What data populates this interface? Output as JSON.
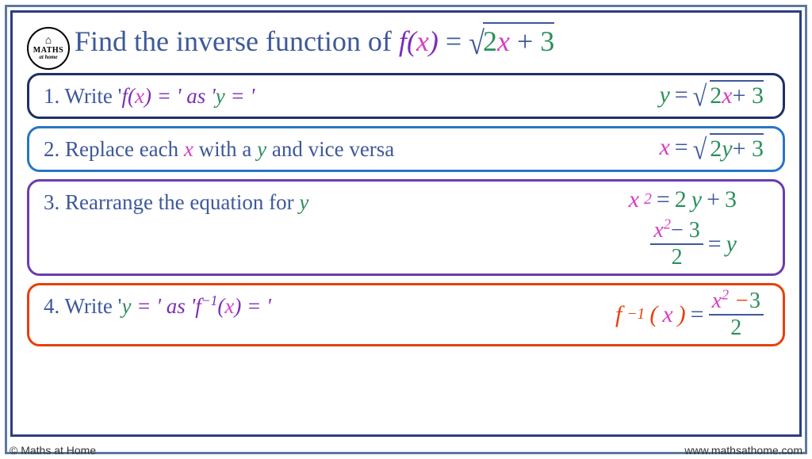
{
  "logo": {
    "line1": "MATHS",
    "line2": "at home"
  },
  "title": {
    "prefix": "Find the inverse function of ",
    "func": "f",
    "var": "x",
    "coef": "2",
    "const": "3"
  },
  "steps": {
    "s1": {
      "num": "1. ",
      "t1": "Write '",
      "fx": "f",
      "t2": "(",
      "x1": "x",
      "t3": ") = ' as '",
      "y": "y",
      "t4": " = '",
      "rhs": {
        "y": "y",
        "coef": "2",
        "x": "x",
        "const": "3"
      }
    },
    "s2": {
      "num": "2. ",
      "t1": "Replace each ",
      "x": "x",
      "t2": " with a ",
      "y": "y",
      "t3": " and vice versa",
      "rhs": {
        "x": "x",
        "coef": "2",
        "y": "y",
        "const": "3"
      }
    },
    "s3": {
      "num": "3. ",
      "t1": "Rearrange the equation for ",
      "y": "y",
      "line1": {
        "x": "x",
        "sq": "2",
        "coef": "2",
        "y": "y",
        "const": "3"
      },
      "line2": {
        "x": "x",
        "sq": "2",
        "const": "3",
        "den": "2",
        "y": "y"
      }
    },
    "s4": {
      "num": "4. ",
      "t1": "Write '",
      "y": "y",
      "t2": " = ' as '",
      "f": "f",
      "inv": "−1",
      "t3": "(",
      "x": "x",
      "t4": ") = '",
      "rhs": {
        "f": "f",
        "inv": "−1",
        "x": "x",
        "xn": "x",
        "sq": "2",
        "const": "3",
        "den": "2"
      }
    }
  },
  "footer": {
    "left": "© Maths at Home",
    "right": "www.mathsathome.com"
  }
}
